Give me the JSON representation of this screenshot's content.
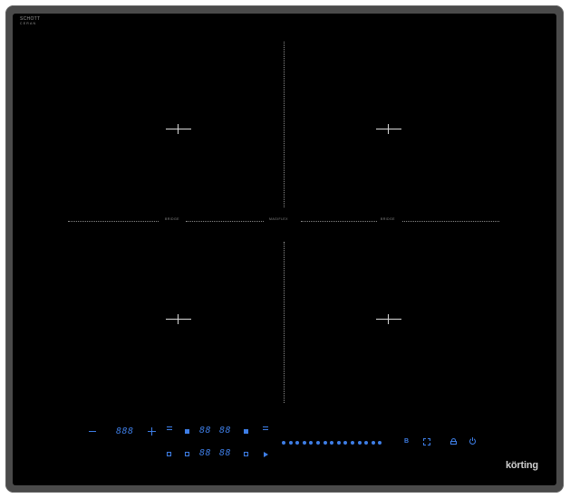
{
  "brand": {
    "model_line1": "SCHOTT",
    "model_line2": "CERAN",
    "logo": "körting"
  },
  "zones": {
    "left_label": "BRIDGE",
    "center_label": "MAGIFLEX",
    "right_label": "BRIDGE"
  },
  "controls": {
    "timer_display": "888",
    "front_top_display_a": "88",
    "front_top_display_b": "88",
    "front_bottom_display_a": "88",
    "front_bottom_display_b": "88",
    "boost_label": "B",
    "slider_steps": 15
  },
  "icons": {
    "minus": "minus-icon",
    "plus": "plus-icon",
    "boost": "boost-icon",
    "bridge": "bridge-zone-icon",
    "lock": "lock-icon",
    "power": "power-icon"
  },
  "colors": {
    "touch_blue": "#3e7ee6",
    "glass": "#000000",
    "frame": "#4a4a4a"
  }
}
